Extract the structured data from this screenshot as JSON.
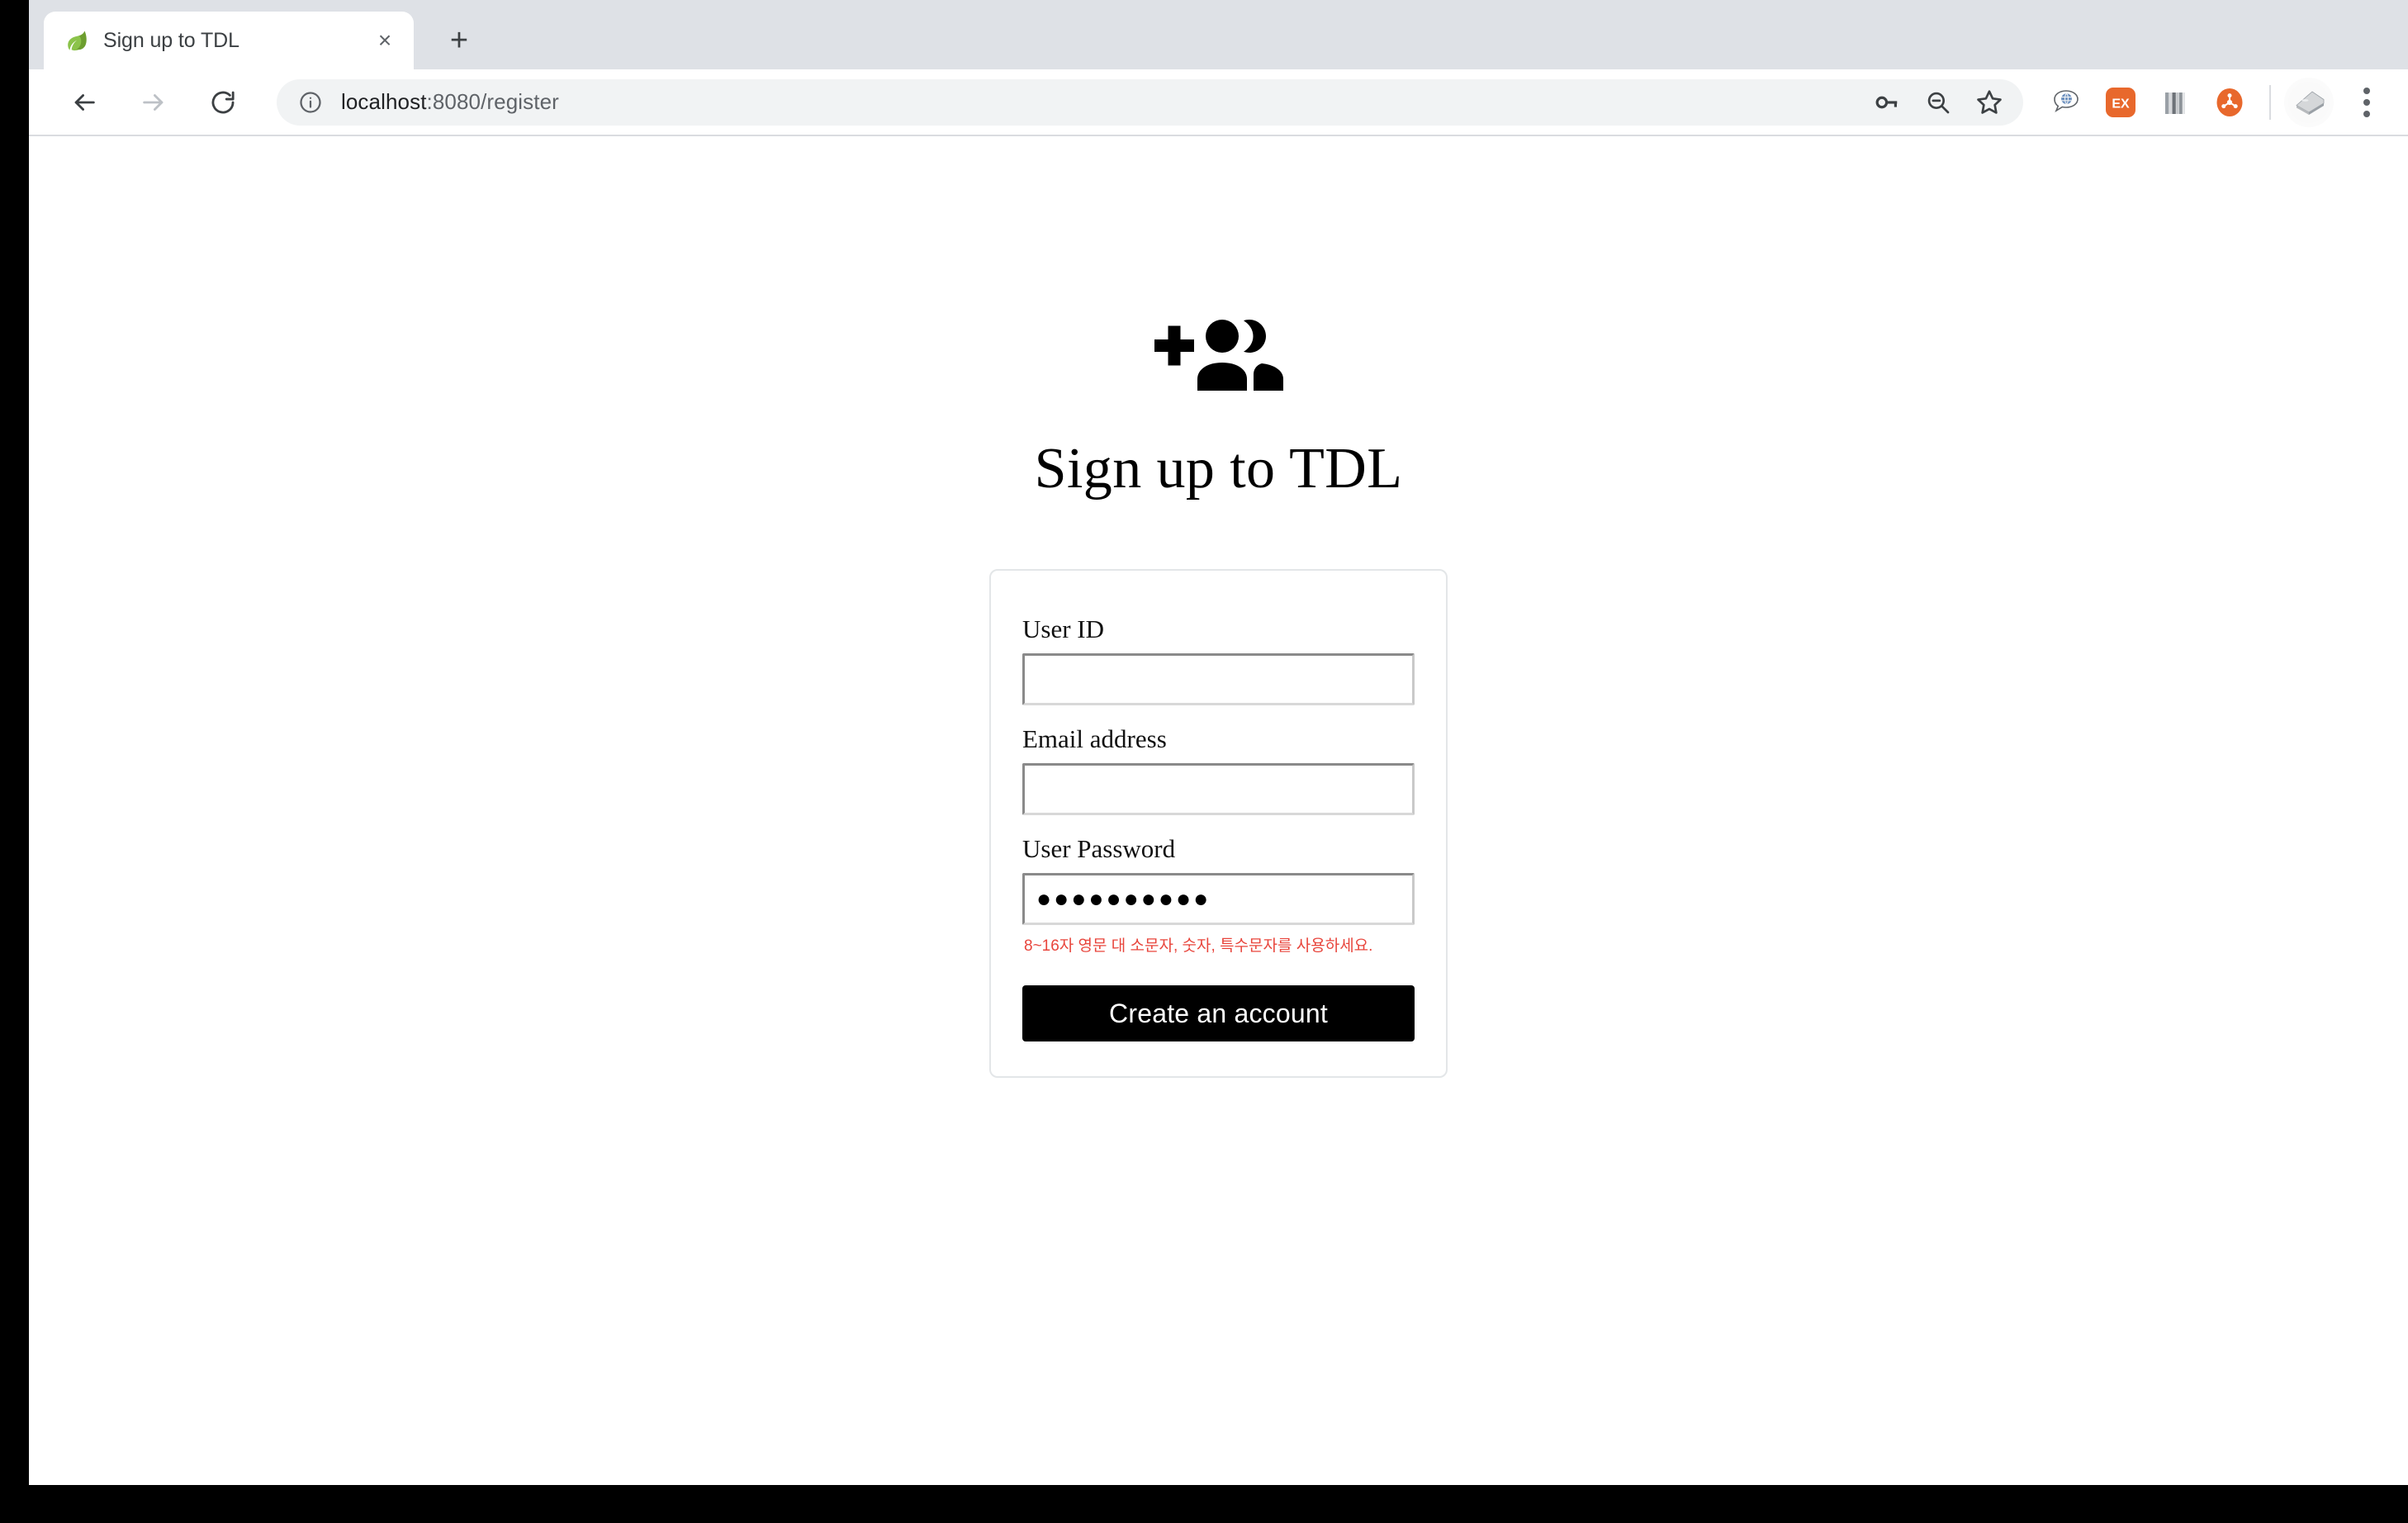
{
  "browser": {
    "tab": {
      "title": "Sign up to TDL",
      "favicon_name": "spring-leaf-favicon",
      "close_glyph": "×"
    },
    "new_tab_glyph": "+",
    "nav": {
      "back_name": "back-button",
      "forward_name": "forward-button",
      "reload_name": "reload-button"
    },
    "omnibox": {
      "host": "localhost",
      "path": ":8080/register",
      "full_url": "localhost:8080/register",
      "site_info_icon": "info-circle-icon"
    },
    "omnibox_actions": [
      {
        "name": "password-key-icon",
        "label": "Passwords"
      },
      {
        "name": "zoom-out-icon",
        "label": "Zoom out"
      },
      {
        "name": "bookmark-star-icon",
        "label": "Bookmark this tab"
      }
    ],
    "extensions": [
      {
        "name": "translate-bubble-extension-icon",
        "label": "Translate"
      },
      {
        "name": "ex-extension-icon",
        "label": "EX",
        "color": "#e8682c"
      },
      {
        "name": "stripes-extension-icon",
        "label": "Stripes"
      },
      {
        "name": "molecule-extension-icon",
        "label": "Molecule",
        "color": "#e8682c"
      }
    ],
    "avatar_name": "profile-avatar",
    "menu_name": "chrome-menu-button"
  },
  "page": {
    "hero_icon": "group-add-icon",
    "title": "Sign up to TDL",
    "form": {
      "fields": [
        {
          "name": "user-id",
          "label": "User ID",
          "value": "",
          "placeholder": "",
          "type": "text"
        },
        {
          "name": "email-address",
          "label": "Email address",
          "value": "",
          "placeholder": "",
          "type": "email"
        },
        {
          "name": "user-password",
          "label": "User Password",
          "value": "●●●●●●●●●●",
          "placeholder": "",
          "type": "password",
          "masked_char_count": 10
        }
      ],
      "password_hint": "8~16자 영문 대 소문자, 숫자, 특수문자를 사용하세요.",
      "password_hint_color": "#e8453c",
      "submit_label": "Create an account",
      "submit_bg": "#000000",
      "submit_fg": "#ffffff"
    }
  }
}
